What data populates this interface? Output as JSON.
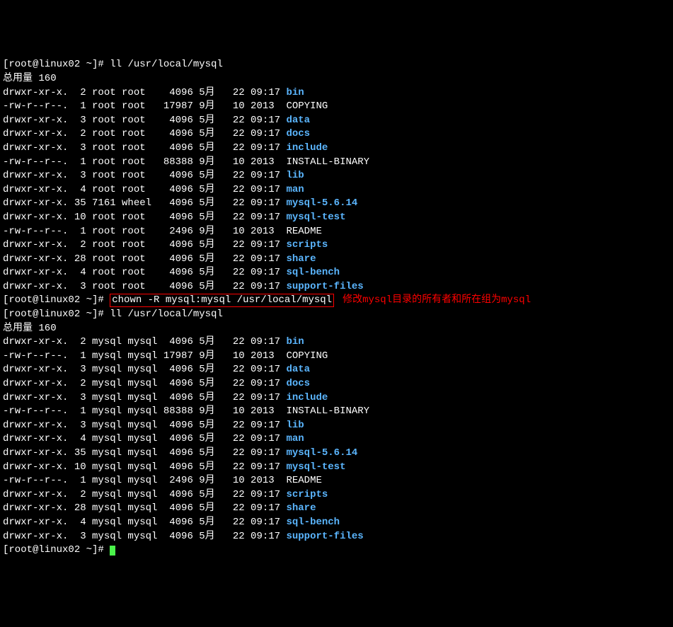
{
  "prompt1": "[root@linux02 ~]# ",
  "cmd1": "ll /usr/local/mysql",
  "total1": "总用量 160",
  "listing1": [
    {
      "perm": "drwxr-xr-x.",
      "lnk": "  2",
      "own": "root",
      "grp": "root ",
      "size": "   4096",
      "mon": "5月 ",
      "day": " 22",
      "time": "09:17",
      "name": "bin",
      "dir": true
    },
    {
      "perm": "-rw-r--r--.",
      "lnk": "  1",
      "own": "root",
      "grp": "root ",
      "size": "  17987",
      "mon": "9月 ",
      "day": " 10",
      "time": "2013 ",
      "name": "COPYING",
      "dir": false
    },
    {
      "perm": "drwxr-xr-x.",
      "lnk": "  3",
      "own": "root",
      "grp": "root ",
      "size": "   4096",
      "mon": "5月 ",
      "day": " 22",
      "time": "09:17",
      "name": "data",
      "dir": true
    },
    {
      "perm": "drwxr-xr-x.",
      "lnk": "  2",
      "own": "root",
      "grp": "root ",
      "size": "   4096",
      "mon": "5月 ",
      "day": " 22",
      "time": "09:17",
      "name": "docs",
      "dir": true
    },
    {
      "perm": "drwxr-xr-x.",
      "lnk": "  3",
      "own": "root",
      "grp": "root ",
      "size": "   4096",
      "mon": "5月 ",
      "day": " 22",
      "time": "09:17",
      "name": "include",
      "dir": true
    },
    {
      "perm": "-rw-r--r--.",
      "lnk": "  1",
      "own": "root",
      "grp": "root ",
      "size": "  88388",
      "mon": "9月 ",
      "day": " 10",
      "time": "2013 ",
      "name": "INSTALL-BINARY",
      "dir": false
    },
    {
      "perm": "drwxr-xr-x.",
      "lnk": "  3",
      "own": "root",
      "grp": "root ",
      "size": "   4096",
      "mon": "5月 ",
      "day": " 22",
      "time": "09:17",
      "name": "lib",
      "dir": true
    },
    {
      "perm": "drwxr-xr-x.",
      "lnk": "  4",
      "own": "root",
      "grp": "root ",
      "size": "   4096",
      "mon": "5月 ",
      "day": " 22",
      "time": "09:17",
      "name": "man",
      "dir": true
    },
    {
      "perm": "drwxr-xr-x.",
      "lnk": " 35",
      "own": "7161",
      "grp": "wheel",
      "size": "   4096",
      "mon": "5月 ",
      "day": " 22",
      "time": "09:17",
      "name": "mysql-5.6.14",
      "dir": true
    },
    {
      "perm": "drwxr-xr-x.",
      "lnk": " 10",
      "own": "root",
      "grp": "root ",
      "size": "   4096",
      "mon": "5月 ",
      "day": " 22",
      "time": "09:17",
      "name": "mysql-test",
      "dir": true
    },
    {
      "perm": "-rw-r--r--.",
      "lnk": "  1",
      "own": "root",
      "grp": "root ",
      "size": "   2496",
      "mon": "9月 ",
      "day": " 10",
      "time": "2013 ",
      "name": "README",
      "dir": false
    },
    {
      "perm": "drwxr-xr-x.",
      "lnk": "  2",
      "own": "root",
      "grp": "root ",
      "size": "   4096",
      "mon": "5月 ",
      "day": " 22",
      "time": "09:17",
      "name": "scripts",
      "dir": true
    },
    {
      "perm": "drwxr-xr-x.",
      "lnk": " 28",
      "own": "root",
      "grp": "root ",
      "size": "   4096",
      "mon": "5月 ",
      "day": " 22",
      "time": "09:17",
      "name": "share",
      "dir": true
    },
    {
      "perm": "drwxr-xr-x.",
      "lnk": "  4",
      "own": "root",
      "grp": "root ",
      "size": "   4096",
      "mon": "5月 ",
      "day": " 22",
      "time": "09:17",
      "name": "sql-bench",
      "dir": true
    },
    {
      "perm": "drwxr-xr-x.",
      "lnk": "  3",
      "own": "root",
      "grp": "root ",
      "size": "   4096",
      "mon": "5月 ",
      "day": " 22",
      "time": "09:17",
      "name": "support-files",
      "dir": true
    }
  ],
  "prompt2": "[root@linux02 ~]# ",
  "cmd2_box": "chown -R mysql:mysql /usr/local/mysql",
  "annotation": "修改mysql目录的所有者和所在组为mysql",
  "prompt3": "[root@linux02 ~]# ",
  "cmd3": "ll /usr/local/mysql",
  "total2": "总用量 160",
  "listing2": [
    {
      "perm": "drwxr-xr-x.",
      "lnk": "  2",
      "own": "mysql",
      "grp": "mysql",
      "size": "  4096",
      "mon": "5月 ",
      "day": " 22",
      "time": "09:17",
      "name": "bin",
      "dir": true
    },
    {
      "perm": "-rw-r--r--.",
      "lnk": "  1",
      "own": "mysql",
      "grp": "mysql",
      "size": " 17987",
      "mon": "9月 ",
      "day": " 10",
      "time": "2013 ",
      "name": "COPYING",
      "dir": false
    },
    {
      "perm": "drwxr-xr-x.",
      "lnk": "  3",
      "own": "mysql",
      "grp": "mysql",
      "size": "  4096",
      "mon": "5月 ",
      "day": " 22",
      "time": "09:17",
      "name": "data",
      "dir": true
    },
    {
      "perm": "drwxr-xr-x.",
      "lnk": "  2",
      "own": "mysql",
      "grp": "mysql",
      "size": "  4096",
      "mon": "5月 ",
      "day": " 22",
      "time": "09:17",
      "name": "docs",
      "dir": true
    },
    {
      "perm": "drwxr-xr-x.",
      "lnk": "  3",
      "own": "mysql",
      "grp": "mysql",
      "size": "  4096",
      "mon": "5月 ",
      "day": " 22",
      "time": "09:17",
      "name": "include",
      "dir": true
    },
    {
      "perm": "-rw-r--r--.",
      "lnk": "  1",
      "own": "mysql",
      "grp": "mysql",
      "size": " 88388",
      "mon": "9月 ",
      "day": " 10",
      "time": "2013 ",
      "name": "INSTALL-BINARY",
      "dir": false
    },
    {
      "perm": "drwxr-xr-x.",
      "lnk": "  3",
      "own": "mysql",
      "grp": "mysql",
      "size": "  4096",
      "mon": "5月 ",
      "day": " 22",
      "time": "09:17",
      "name": "lib",
      "dir": true
    },
    {
      "perm": "drwxr-xr-x.",
      "lnk": "  4",
      "own": "mysql",
      "grp": "mysql",
      "size": "  4096",
      "mon": "5月 ",
      "day": " 22",
      "time": "09:17",
      "name": "man",
      "dir": true
    },
    {
      "perm": "drwxr-xr-x.",
      "lnk": " 35",
      "own": "mysql",
      "grp": "mysql",
      "size": "  4096",
      "mon": "5月 ",
      "day": " 22",
      "time": "09:17",
      "name": "mysql-5.6.14",
      "dir": true
    },
    {
      "perm": "drwxr-xr-x.",
      "lnk": " 10",
      "own": "mysql",
      "grp": "mysql",
      "size": "  4096",
      "mon": "5月 ",
      "day": " 22",
      "time": "09:17",
      "name": "mysql-test",
      "dir": true
    },
    {
      "perm": "-rw-r--r--.",
      "lnk": "  1",
      "own": "mysql",
      "grp": "mysql",
      "size": "  2496",
      "mon": "9月 ",
      "day": " 10",
      "time": "2013 ",
      "name": "README",
      "dir": false
    },
    {
      "perm": "drwxr-xr-x.",
      "lnk": "  2",
      "own": "mysql",
      "grp": "mysql",
      "size": "  4096",
      "mon": "5月 ",
      "day": " 22",
      "time": "09:17",
      "name": "scripts",
      "dir": true
    },
    {
      "perm": "drwxr-xr-x.",
      "lnk": " 28",
      "own": "mysql",
      "grp": "mysql",
      "size": "  4096",
      "mon": "5月 ",
      "day": " 22",
      "time": "09:17",
      "name": "share",
      "dir": true
    },
    {
      "perm": "drwxr-xr-x.",
      "lnk": "  4",
      "own": "mysql",
      "grp": "mysql",
      "size": "  4096",
      "mon": "5月 ",
      "day": " 22",
      "time": "09:17",
      "name": "sql-bench",
      "dir": true
    },
    {
      "perm": "drwxr-xr-x.",
      "lnk": "  3",
      "own": "mysql",
      "grp": "mysql",
      "size": "  4096",
      "mon": "5月 ",
      "day": " 22",
      "time": "09:17",
      "name": "support-files",
      "dir": true
    }
  ],
  "prompt4": "[root@linux02 ~]# "
}
